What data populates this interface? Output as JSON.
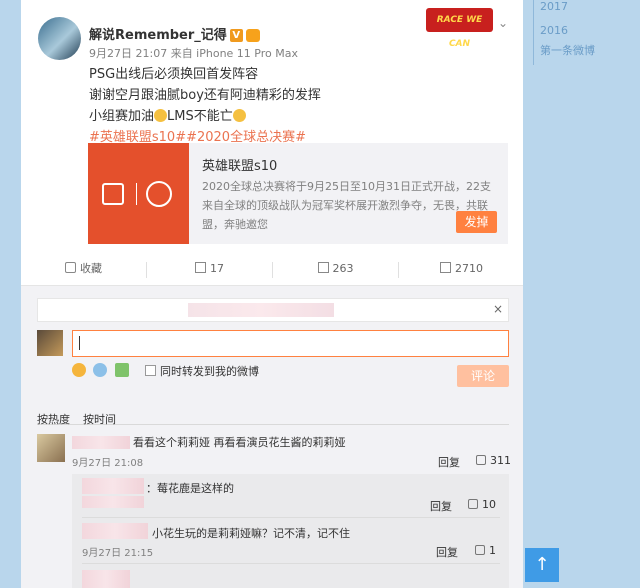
{
  "post": {
    "username": "解说Remember_记得",
    "badge_v": "V",
    "meta": "9月27日 21:07 来自 iPhone 11 Pro Max",
    "logo_text": "RACE WE CAN",
    "lines": [
      "PSG出线后必须换回首发阵容",
      "谢谢空月跟油腻boy还有阿迪精彩的发挥",
      "小组赛加油",
      "LMS不能亡"
    ],
    "topics": "#英雄联盟s10##2020全球总决赛#"
  },
  "share": {
    "title": "英雄联盟s10",
    "desc": "2020全球总决赛将于9月25日至10月31日正式开战，22支来自全球的顶级战队为冠军奖杯展开激烈争夺，无畏，共联盟，奔驰邀您",
    "button": "发掉"
  },
  "actions": {
    "favorite": "收藏",
    "forward": "17",
    "comments": "263",
    "likes": "2710"
  },
  "comment_box": {
    "notice_close": "×",
    "sync_label": "同时转发到我的微博",
    "submit": "评论"
  },
  "sorts": {
    "by_hot": "按热度",
    "by_time": "按时间"
  },
  "comments": [
    {
      "text": "看看这个莉莉娅  再看看演员花生酱的莉莉娅",
      "time": "9月27日 21:08",
      "reply": "回复",
      "likes": "311"
    }
  ],
  "sub_comments": [
    {
      "text": "：莓花鹿是这样的",
      "reply": "回复",
      "likes": "10"
    },
    {
      "text": "小花生玩的是莉莉娅嘛？记不清，记不住",
      "time": "9月27日 21:15",
      "reply": "回复",
      "likes": "1"
    }
  ],
  "timeline": {
    "year1": "2017",
    "year2": "2016",
    "first": "第一条微博"
  },
  "colors": {
    "accent": "#ff8140",
    "topic": "#eb7350",
    "bg": "#b9d6ec"
  }
}
